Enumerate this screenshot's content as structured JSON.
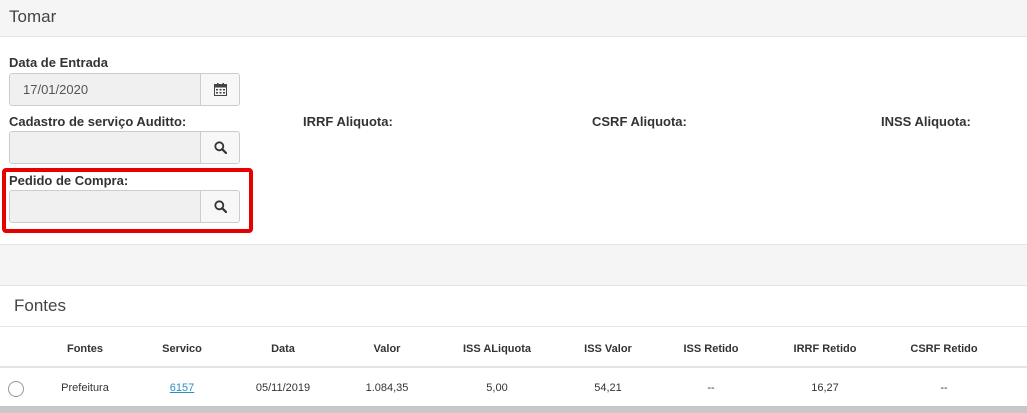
{
  "panel": {
    "title": "Tomar"
  },
  "form": {
    "data_entrada": {
      "label": "Data de Entrada",
      "value": "17/01/2020"
    },
    "cadastro_servico": {
      "label": "Cadastro de serviço Auditto:",
      "value": ""
    },
    "pedido_compra": {
      "label": "Pedido de Compra:",
      "value": ""
    },
    "irrf_label": "IRRF Aliquota:",
    "csrf_label": "CSRF Aliquota:",
    "inss_label": "INSS Aliquota:"
  },
  "highlight_color": "#e60000",
  "fontes": {
    "title": "Fontes",
    "columns": [
      "Fontes",
      "Servico",
      "Data",
      "Valor",
      "ISS ALiquota",
      "ISS Valor",
      "ISS Retido",
      "IRRF Retido",
      "CSRF Retido"
    ],
    "rows": [
      [
        "Prefeitura",
        "6157",
        "05/11/2019",
        "1.084,35",
        "5,00",
        "54,21",
        "--",
        "16,27",
        "--"
      ]
    ]
  },
  "icons": {
    "date_picker": "calendar-icon",
    "search": "search-icon",
    "row_select": "radio-icon"
  }
}
